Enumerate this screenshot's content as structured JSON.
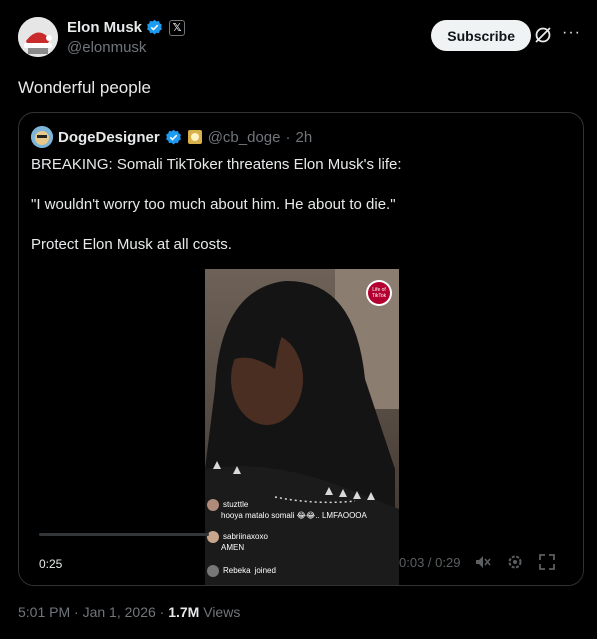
{
  "author": {
    "name": "Elon Musk",
    "handle": "@elonmusk",
    "x_badge": "𝕏",
    "verified_icon": "verified-badge-icon",
    "verified_color": "#1d9bf0"
  },
  "actions": {
    "subscribe_label": "Subscribe",
    "grok_icon": "grok-icon",
    "more_label": "···"
  },
  "tweet": {
    "text": "Wonderful people"
  },
  "quote": {
    "name": "DogeDesigner",
    "handle": "@cb_doge",
    "separator": "·",
    "age": "2h",
    "lines": [
      "BREAKING: Somali TikToker threatens Elon Musk's life:",
      "\"I wouldn't worry too much about him. He about to die.\"",
      "Protect Elon Musk at all costs."
    ],
    "video": {
      "elapsed": "0:25",
      "time_readout": "0:03 / 0:29",
      "overlay_comments": [
        {
          "user": "stuzttle",
          "text": "hooya matalo somali 😂😂.. LMFAOOOA"
        },
        {
          "user": "sabriinaxoxo",
          "text": "AMEN"
        },
        {
          "user": "Rebeka",
          "text": "joined"
        }
      ],
      "watermark": "Life of TikTok"
    }
  },
  "meta": {
    "time": "5:01 PM",
    "separator": "·",
    "date": "Jan 1, 2026",
    "views_count": "1.7M",
    "views_label": "Views"
  }
}
